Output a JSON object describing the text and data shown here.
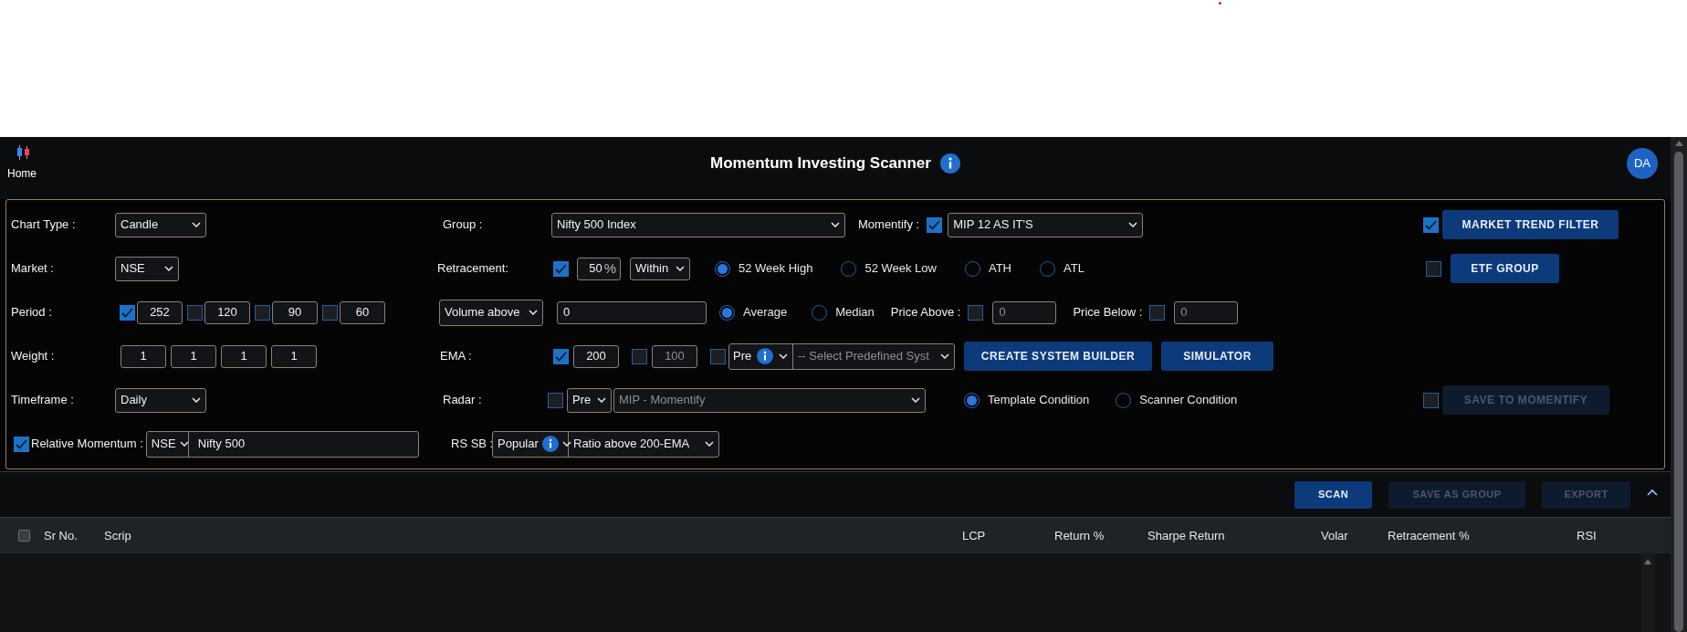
{
  "header": {
    "home": "Home",
    "title": "Momentum Investing Scanner",
    "avatar": "DA"
  },
  "chart_type": {
    "label": "Chart Type :",
    "value": "Candle"
  },
  "market": {
    "label": "Market :",
    "value": "NSE"
  },
  "period": {
    "label": "Period :",
    "items": [
      {
        "value": "252",
        "checked": true
      },
      {
        "value": "120",
        "checked": false
      },
      {
        "value": "90",
        "checked": false
      },
      {
        "value": "60",
        "checked": false
      }
    ]
  },
  "weight": {
    "label": "Weight :",
    "values": [
      "1",
      "1",
      "1",
      "1"
    ]
  },
  "timeframe": {
    "label": "Timeframe :",
    "value": "Daily"
  },
  "relative_momentum": {
    "label": "Relative Momentum :",
    "checked": true,
    "market": "NSE",
    "index": "Nifty 500"
  },
  "group": {
    "label": "Group :",
    "value": "Nifty 500 Index"
  },
  "momentify": {
    "label": "Momentify :",
    "checked": true,
    "value": "MIP 12 AS IT'S"
  },
  "retracement": {
    "label": "Retracement:",
    "checked": true,
    "value": "50",
    "unit": "%",
    "mode": "Within",
    "options": [
      {
        "label": "52 Week High",
        "selected": true
      },
      {
        "label": "52 Week Low",
        "selected": false
      },
      {
        "label": "ATH",
        "selected": false
      },
      {
        "label": "ATL",
        "selected": false
      }
    ]
  },
  "volume": {
    "type": "Volume above",
    "value": "0",
    "options": [
      {
        "label": "Average",
        "selected": true
      },
      {
        "label": "Median",
        "selected": false
      }
    ]
  },
  "price_filters": [
    {
      "label": "Price Above :",
      "checked": false,
      "value": "0"
    },
    {
      "label": "Price Below :",
      "checked": false,
      "value": "0"
    }
  ],
  "ema": {
    "label": "EMA :",
    "items": [
      {
        "value": "200",
        "checked": true
      },
      {
        "value": "100",
        "checked": false
      }
    ],
    "system": {
      "checked": false,
      "source": "Pre",
      "value": "-- Select Predefined Syst"
    }
  },
  "actions": [
    {
      "label": "CREATE SYSTEM BUILDER"
    },
    {
      "label": "SIMULATOR"
    }
  ],
  "radar": {
    "label": "Radar :",
    "checked": false,
    "source": "Pre",
    "value": "MIP - Momentify",
    "options": [
      {
        "label": "Template Condition",
        "selected": true
      },
      {
        "label": "Scanner Condition",
        "selected": false
      }
    ]
  },
  "rs_sb": {
    "label": "RS SB :",
    "source": "Popular",
    "value": "Ratio above 200-EMA"
  },
  "side": [
    {
      "label": "MARKET TREND FILTER",
      "checked": true,
      "disabled": false
    },
    {
      "label": "ETF GROUP",
      "checked": false,
      "disabled": false
    },
    {
      "label": "SAVE TO MOMENTIFY",
      "checked": false,
      "disabled": true
    }
  ],
  "toolbar": [
    {
      "label": "SCAN",
      "disabled": false
    },
    {
      "label": "SAVE AS GROUP",
      "disabled": true
    },
    {
      "label": "EXPORT",
      "disabled": true
    }
  ],
  "table": {
    "select_all": false,
    "columns": [
      "Sr No.",
      "Scrip",
      "LCP",
      "Return %",
      "Sharpe Return",
      "Volar",
      "Retracement %",
      "RSI"
    ]
  }
}
